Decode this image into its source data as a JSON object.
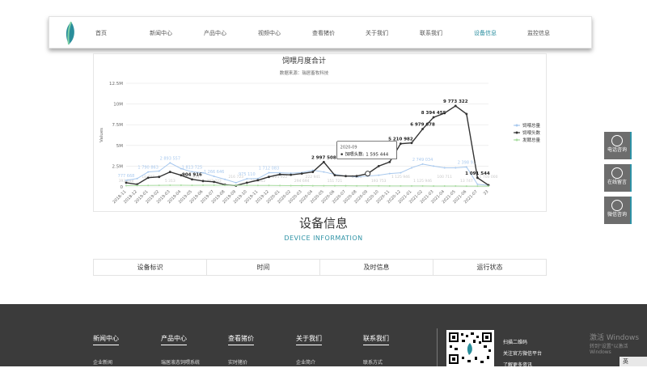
{
  "nav": {
    "items": [
      {
        "label": "首页",
        "active": false
      },
      {
        "label": "新闻中心",
        "active": false
      },
      {
        "label": "产品中心",
        "active": false
      },
      {
        "label": "视频中心",
        "active": false
      },
      {
        "label": "查看猪价",
        "active": false
      },
      {
        "label": "关于我们",
        "active": false
      },
      {
        "label": "联系我们",
        "active": false
      },
      {
        "label": "设备信息",
        "active": true
      },
      {
        "label": "监控信息",
        "active": false
      }
    ]
  },
  "chart_data": {
    "type": "line",
    "title": "饲喂月度合计",
    "subtitle": "数据来源：瑞居畜牧科技",
    "ylabel": "Values",
    "ylim": [
      0,
      12500000
    ],
    "y_ticks": [
      "0",
      "2.5M",
      "5M",
      "7.5M",
      "10M",
      "12.5M"
    ],
    "categories": [
      "2018-11",
      "2018-12",
      "2019-01",
      "2019-02",
      "2019-03",
      "2019-04",
      "2019-05",
      "2019-06",
      "2019-07",
      "2019-08",
      "2019-09",
      "2019-10",
      "2019-11",
      "2019-12",
      "2020-01",
      "2020-02",
      "2020-03",
      "2020-04",
      "2020-05",
      "2020-06",
      "2020-07",
      "2020-08",
      "2020-09",
      "2020-10",
      "2020-11",
      "2020-12",
      "2021-01",
      "2021-02",
      "2021-03",
      "2021-04",
      "2021-05",
      "2021-06",
      "2021-07",
      "33"
    ],
    "series": [
      {
        "name": "饲喂总量",
        "color": "#a9c9ee",
        "values": [
          777668,
          1000000,
          1790863,
          1900000,
          2893557,
          2200000,
          1813725,
          1700000,
          1266646,
          900000,
          500000,
          975110,
          1000000,
          1712083,
          1700000,
          1650000,
          1725000,
          2000000,
          1800000,
          1500000,
          1300000,
          1200000,
          1300000,
          1400000,
          1600000,
          1700000,
          2300000,
          2749034,
          2500000,
          2300000,
          2300000,
          2398000,
          300000,
          200000
        ]
      },
      {
        "name": "饲喂头数",
        "color": "#333333",
        "values": [
          500000,
          300000,
          1100000,
          1200000,
          1800000,
          1400000,
          904916,
          700000,
          600000,
          250000,
          150000,
          500000,
          800000,
          1200000,
          1500000,
          1450000,
          1600000,
          1800000,
          2997508,
          1400000,
          1300000,
          1300000,
          1595444,
          2500000,
          3000000,
          5210982,
          5300000,
          6979678,
          8394455,
          8900000,
          9773322,
          8800000,
          1091544,
          200000
        ]
      },
      {
        "name": "发酵总量",
        "color": "#a8dca0",
        "values": [
          150000,
          160000,
          170000,
          180000,
          190000,
          200000,
          185000,
          190000,
          200000,
          190000,
          185000,
          180000,
          175000,
          170000,
          160000,
          150000,
          145000,
          140000,
          135000,
          130000,
          130000,
          125000,
          120000,
          120000,
          115000,
          110000,
          110000,
          105000,
          100000,
          100000,
          95000,
          90000,
          90000,
          85000
        ]
      }
    ],
    "data_labels": {
      "饲喂总量": [
        "777 668",
        "1 790 863",
        "2 893 557",
        "1 813 725",
        "1 266 646",
        "975 110",
        "1 712 083",
        "2 749 034",
        "2 398 9.."
      ],
      "饲喂头数": [
        "904 916",
        "2 997 508",
        "5 210 982",
        "6 979 678",
        "8 394 455",
        "9 773 322",
        "1 091 544"
      ],
      "faint_bottom": [
        "393 888",
        "18 747",
        "5 313",
        "395 911",
        "387 222",
        "216 723",
        "193 462",
        "224 922",
        "294 694",
        "222 941",
        "151 721",
        "5 313",
        "193 753",
        "1 125 946",
        "1 125 946",
        "100 711",
        "13 747",
        "1 700 000"
      ]
    },
    "tooltip": {
      "category": "2020-09",
      "series": "饲喂头数",
      "value": "1 595 444",
      "label": "饲喂头数: 1 595 444"
    },
    "legend_position": "right",
    "grid": true
  },
  "section": {
    "title": "设备信息",
    "subtitle": "DEVICE INFORMATION"
  },
  "table": {
    "headers": [
      "设备标识",
      "时间",
      "及时信息",
      "运行状态"
    ]
  },
  "side_tools": [
    {
      "label": "电话咨询",
      "icon": "phone-icon"
    },
    {
      "label": "在线留言",
      "icon": "headset-icon"
    },
    {
      "label": "微信咨询",
      "icon": "wechat-icon"
    }
  ],
  "footer": {
    "columns": [
      {
        "head": "新闻中心",
        "link": "企业新闻"
      },
      {
        "head": "产品中心",
        "link": "瑞居液态饲喂系统"
      },
      {
        "head": "查看猪价",
        "link": "实时猪价"
      },
      {
        "head": "关于我们",
        "link": "企业简介"
      },
      {
        "head": "联系我们",
        "link": "联系方式"
      }
    ],
    "qr_text": [
      "扫描二维码",
      "关注官方微信平台",
      "了解更多资讯"
    ]
  },
  "os": {
    "watermark": "激活 Windows",
    "watermark_sub": "转到\"设置\"以激活 Windows",
    "ime": "英"
  },
  "colors": {
    "accent": "#2e92a5",
    "footer_bg": "#3b3b3b",
    "side_bg": "#6d6d6d"
  }
}
